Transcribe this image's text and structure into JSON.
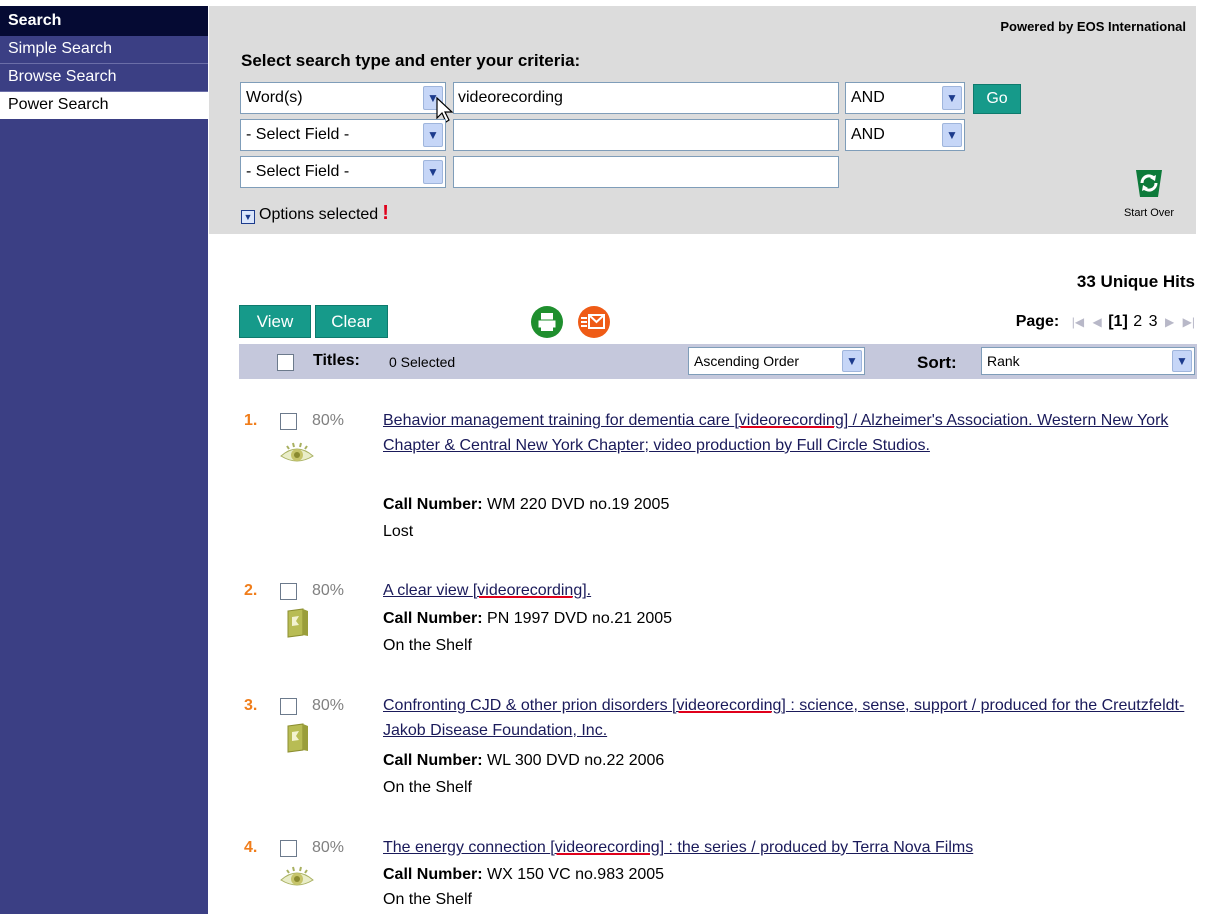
{
  "sidebar": {
    "title": "Search",
    "items": [
      {
        "label": "Simple Search"
      },
      {
        "label": "Browse Search"
      },
      {
        "label": "Power Search"
      }
    ]
  },
  "panel": {
    "powered_by": "Powered by EOS International",
    "heading": "Select search type and enter your criteria:",
    "rows": [
      {
        "field": "Word(s)",
        "value": "videorecording",
        "operator": "AND"
      },
      {
        "field": "- Select Field -",
        "value": "",
        "operator": "AND"
      },
      {
        "field": "- Select Field -",
        "value": ""
      }
    ],
    "go_label": "Go",
    "options_label": "Options selected",
    "options_alert": "!",
    "start_over_label": "Start Over"
  },
  "results_header": {
    "hits": "33 Unique Hits",
    "view_label": "View",
    "clear_label": "Clear",
    "page_label": "Page:",
    "current_page": "[1]",
    "pages": [
      "2",
      "3"
    ],
    "titles_label": "Titles:",
    "titles_selected": "0 Selected",
    "order": "Ascending Order",
    "sort_label": "Sort:",
    "sort_value": "Rank"
  },
  "results": [
    {
      "num": "1.",
      "relevance": "80%",
      "icon": "eye-icon",
      "title_pre": "Behavior management training for dementia care ",
      "title_hl": "[videorecording]",
      "title_post": " / Alzheimer's Association. Western New York Chapter & Central New York Chapter; video production by Full Circle Studios.",
      "call_label": "Call Number:",
      "call_number": "WM 220 DVD no.19 2005",
      "status": "Lost"
    },
    {
      "num": "2.",
      "relevance": "80%",
      "icon": "book-icon",
      "title_pre": "A clear view ",
      "title_hl": "[videorecording]",
      "title_post": ".",
      "call_label": "Call Number:",
      "call_number": "PN 1997 DVD no.21 2005",
      "status": "On the Shelf"
    },
    {
      "num": "3.",
      "relevance": "80%",
      "icon": "book-icon",
      "title_pre": "Confronting CJD & other prion disorders ",
      "title_hl": "[videorecording]",
      "title_post": " : science, sense, support / produced for the Creutzfeldt-Jakob Disease Foundation, Inc.",
      "call_label": "Call Number:",
      "call_number": "WL 300 DVD no.22 2006",
      "status": "On the Shelf"
    },
    {
      "num": "4.",
      "relevance": "80%",
      "icon": "eye-icon",
      "title_pre": "The energy connection ",
      "title_hl": "[videorecording]",
      "title_post": " : the series / produced by Terra Nova Films",
      "call_label": "Call Number:",
      "call_number": "WX 150 VC no.983 2005",
      "status": "On the Shelf"
    }
  ],
  "colors": {
    "sidebar_bg": "#3b3f84",
    "sidebar_title_bg": "#050a33",
    "teal_button": "#169a8a",
    "result_number": "#f07d1a",
    "highlight_underline": "#e0001b"
  }
}
